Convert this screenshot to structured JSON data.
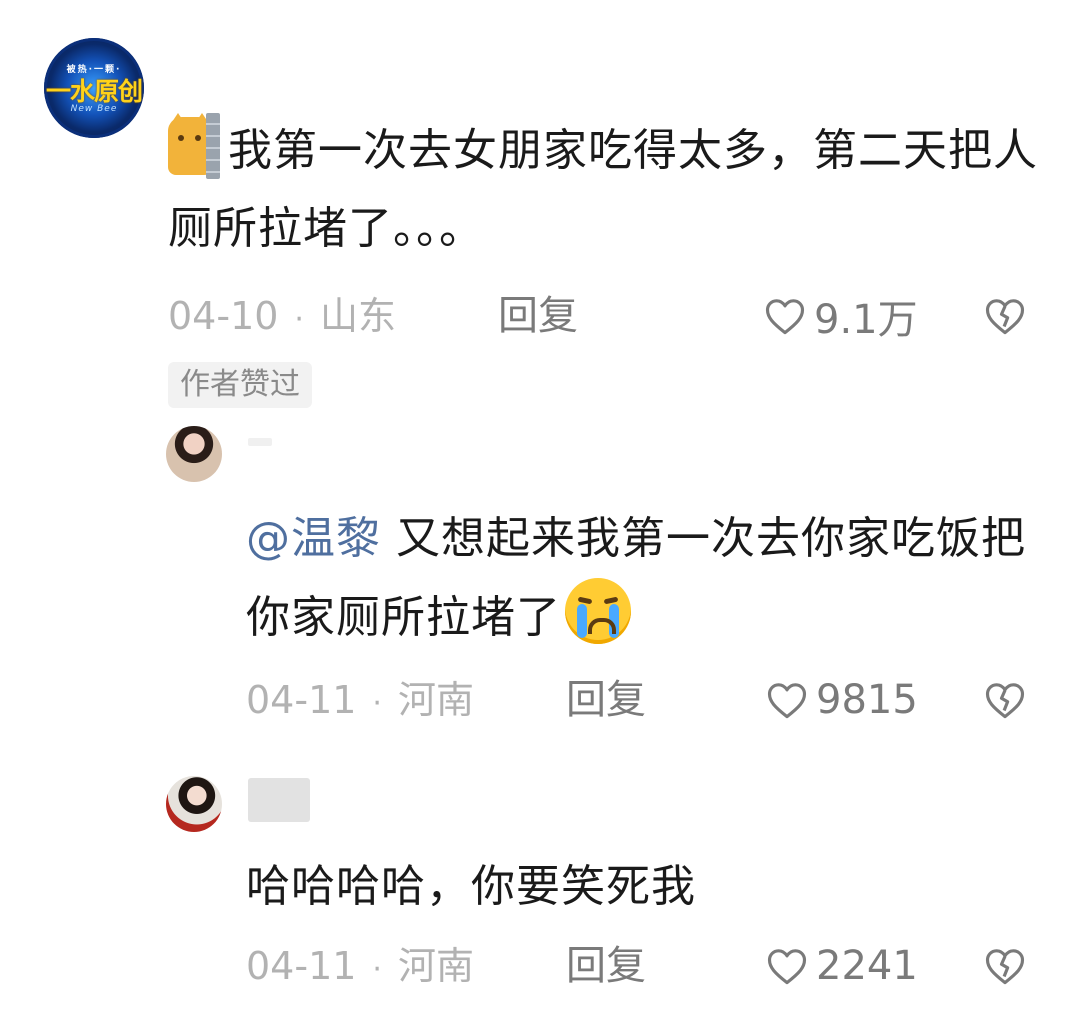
{
  "comment": {
    "avatar_text": {
      "top": "被热·一颗·",
      "main": "一水原创",
      "bottom": "New Bee"
    },
    "text": "我第一次去女朋家吃得太多，第二天把人厕所拉堵了。。。",
    "emoji": "cat-hiding-behind-wall",
    "date": "04-10",
    "region": "山东",
    "reply_label": "回复",
    "likes": "9.1万",
    "badge": "作者赞过"
  },
  "replies": [
    {
      "mention": "@温黎",
      "text": "又想起来我第一次去你家吃饭把你家厕所拉堵了",
      "emoji": "crying-face",
      "date": "04-11",
      "region": "河南",
      "reply_label": "回复",
      "likes": "9815"
    },
    {
      "text": "哈哈哈哈，你要笑死我",
      "date": "04-11",
      "region": "河南",
      "reply_label": "回复",
      "likes": "2241"
    }
  ],
  "colors": {
    "mention": "#4f6f9f",
    "meta": "#b2b2b2",
    "action": "#7a7a7a",
    "badge_bg": "#f2f2f2"
  },
  "icons": {
    "like": "heart-outline-icon",
    "dislike": "broken-heart-icon"
  }
}
